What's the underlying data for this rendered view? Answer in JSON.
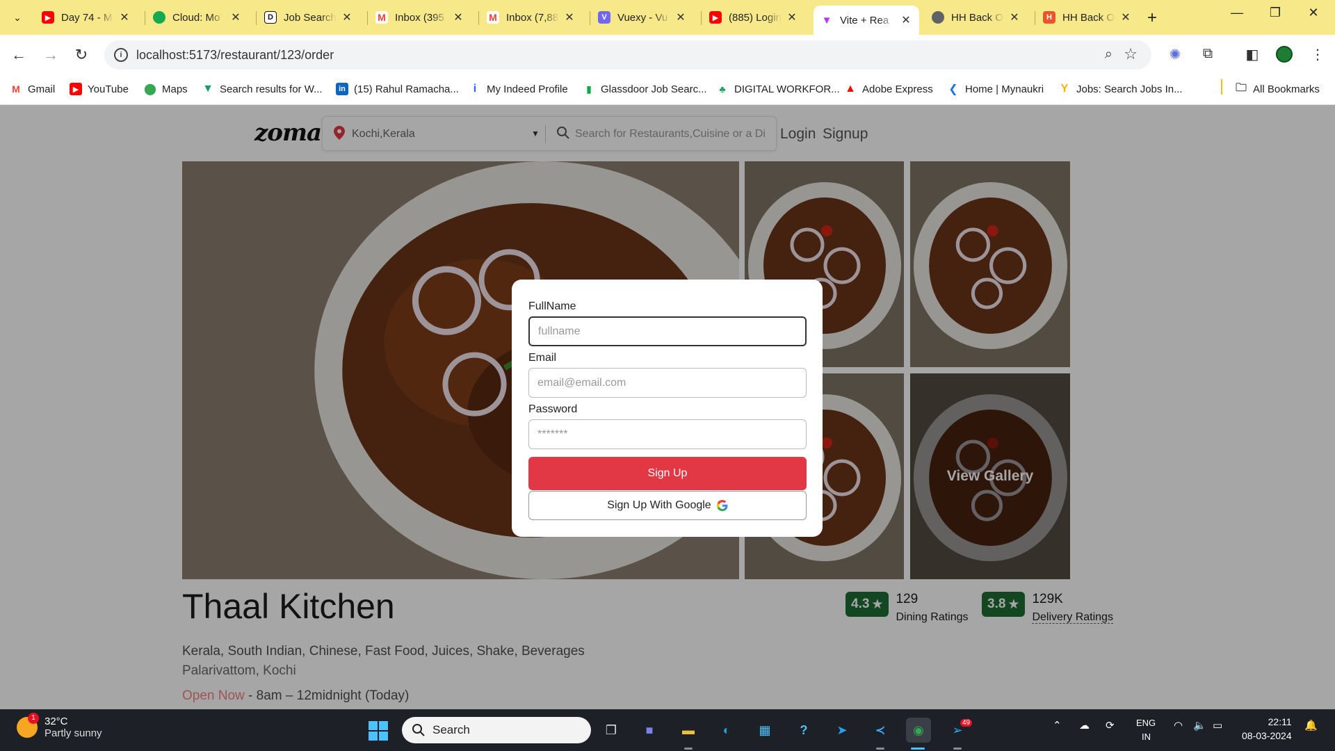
{
  "browser": {
    "tabs": [
      {
        "title": "Day 74 - M",
        "icon": "youtube-icon",
        "color": "#ff0000"
      },
      {
        "title": "Cloud: Mo",
        "icon": "mongodb-icon",
        "color": "#13aa52"
      },
      {
        "title": "Job Search",
        "icon": "dice-icon",
        "color": "#111111"
      },
      {
        "title": "Inbox (395",
        "icon": "gmail-icon",
        "color": "#ea4335"
      },
      {
        "title": "Inbox (7,88",
        "icon": "gmail-icon",
        "color": "#ea4335"
      },
      {
        "title": "Vuexy - Vu",
        "icon": "vuexy-icon",
        "color": "#7367f0"
      },
      {
        "title": "(885) Login",
        "icon": "youtube-icon",
        "color": "#ff0000"
      },
      {
        "title": "Vite + Rea",
        "icon": "vite-icon",
        "color": "#bd34fe",
        "active": true
      },
      {
        "title": "HH Back O",
        "icon": "globe-icon",
        "color": "#5f6368"
      },
      {
        "title": "HH Back O",
        "icon": "hh-icon",
        "color": "#e8552b"
      }
    ],
    "url": "localhost:5173/restaurant/123/order",
    "bookmarks": [
      {
        "label": "Gmail",
        "icon": "gmail-icon",
        "color": "#ea4335"
      },
      {
        "label": "YouTube",
        "icon": "youtube-icon",
        "color": "#ff0000"
      },
      {
        "label": "Maps",
        "icon": "maps-pin-icon",
        "color": "#34a853"
      },
      {
        "label": "Search results for W...",
        "icon": "vuetify-icon",
        "color": "#1867c0"
      },
      {
        "label": "(15) Rahul Ramacha...",
        "icon": "linkedin-icon",
        "color": "#0a66c2"
      },
      {
        "label": "My Indeed Profile",
        "icon": "indeed-icon",
        "color": "#2164f3"
      },
      {
        "label": "Glassdoor Job Searc...",
        "icon": "glassdoor-icon",
        "color": "#0caa41"
      },
      {
        "label": "DIGITAL WORKFOR...",
        "icon": "workforce-icon",
        "color": "#1aa260"
      },
      {
        "label": "Adobe Express",
        "icon": "adobe-icon",
        "color": "#eb1000"
      },
      {
        "label": "Home | Mynaukri",
        "icon": "mynaukri-icon",
        "color": "#1a73e8"
      },
      {
        "label": "Jobs: Search Jobs In...",
        "icon": "jobs-icon",
        "color": "#f4b400"
      }
    ],
    "all_bookmarks": "All Bookmarks"
  },
  "site": {
    "logo": "zomato",
    "location": "Kochi,Kerala",
    "search_placeholder": "Search for Restaurants,Cuisine or a Di",
    "login": "Login",
    "signup": "Signup",
    "view_gallery": "View Gallery",
    "brand_color": "#e23744"
  },
  "restaurant": {
    "name": "Thaal Kitchen",
    "cuisines": "Kerala, South Indian, Chinese, Fast Food, Juices, Shake, Beverages",
    "address": "Palarivattom, Kochi",
    "open_status": "Open Now",
    "hours": " - 8am – 12midnight (Today)",
    "dining_rating": "4.3",
    "dining_count": "129",
    "dining_label": "Dining Ratings",
    "delivery_rating": "3.8",
    "delivery_count": "129K",
    "delivery_label": "Delivery Ratings"
  },
  "signup_modal": {
    "fullname_label": "FullName",
    "fullname_placeholder": "fullname",
    "email_label": "Email",
    "email_placeholder": "email@email.com",
    "password_label": "Password",
    "password_placeholder": "*******",
    "signup_button": "Sign Up",
    "google_button": "Sign Up With Google"
  },
  "taskbar": {
    "weather_temp": "32°C",
    "weather_desc": "Partly sunny",
    "weather_badge": "1",
    "search": "Search",
    "language_top": "ENG",
    "language_bottom": "IN",
    "time": "22:11",
    "date": "08-03-2024",
    "telegram_badge": "49"
  }
}
